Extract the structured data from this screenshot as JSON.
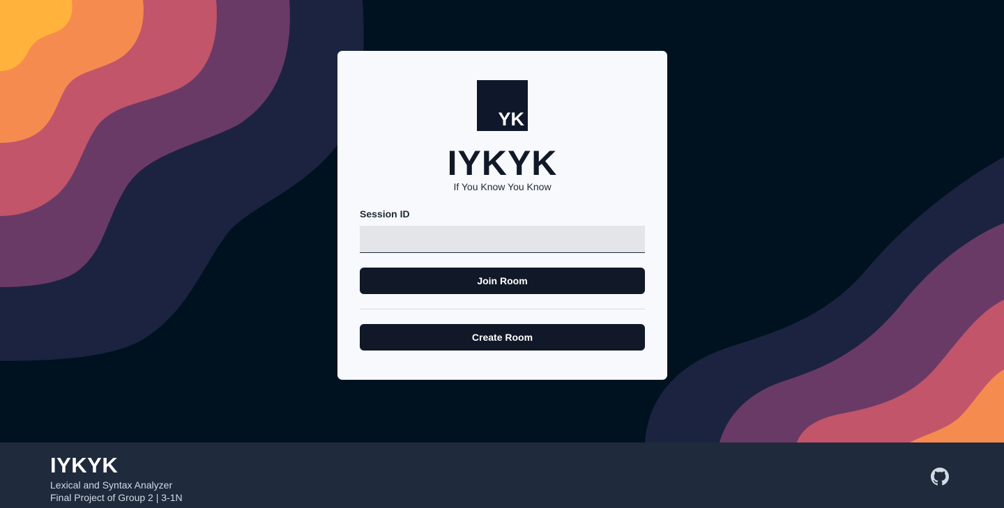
{
  "logo": {
    "mark": "YK"
  },
  "card": {
    "title": "IYKYK",
    "subtitle": "If You Know You Know",
    "session_label": "Session ID",
    "session_value": "",
    "join_label": "Join Room",
    "create_label": "Create Room"
  },
  "footer": {
    "title": "IYKYK",
    "line1": "Lexical and Syntax Analyzer",
    "line2": "Final Project of Group 2 | 3-1N",
    "icon": "github-icon"
  },
  "colors": {
    "background": "#001220",
    "wave1": "#1b2340",
    "wave2": "#6a3a67",
    "wave3": "#c2556a",
    "wave4": "#f68b50",
    "wave5": "#ffb23c",
    "button": "#111827",
    "footer": "#1f2a3c"
  }
}
